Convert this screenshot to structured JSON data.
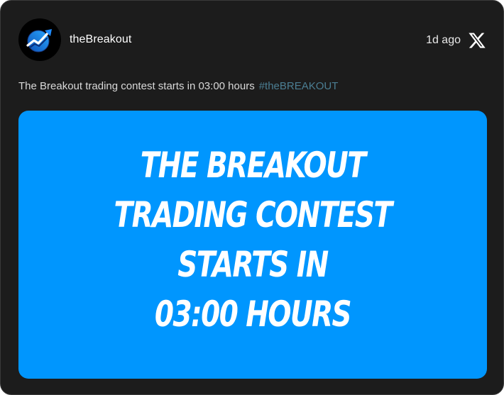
{
  "post": {
    "author": {
      "name": "theBreakout",
      "avatar_icon": "breakout-chart-logo-icon"
    },
    "timestamp": "1d ago",
    "platform_icon": "x-logo-icon",
    "text": "The Breakout trading contest starts in 03:00 hours",
    "hashtag": "#theBREAKOUT",
    "media": {
      "background_color": "#0096fe",
      "lines": [
        "THE BREAKOUT",
        "TRADING CONTEST",
        "STARTS IN",
        "03:00 HOURS"
      ]
    }
  },
  "colors": {
    "card_background": "#1c1c1c",
    "hashtag": "#4b7e93",
    "accent_blue": "#0096fe"
  }
}
